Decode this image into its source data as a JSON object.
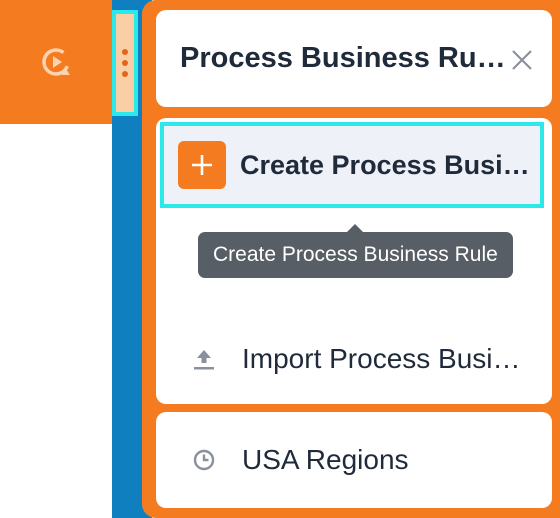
{
  "sidebar": {
    "tab_icon": "process-cycle-icon"
  },
  "kebab_menu": {
    "icon": "vertical-dots-icon"
  },
  "panel": {
    "title": "Process Business Rules",
    "close_icon": "close-icon",
    "menu": {
      "create_label": "Create Process Business Rule",
      "create_icon": "plus-icon",
      "tooltip": "Create Process Business Rule",
      "import_label": "Import Process Business Rules",
      "import_icon": "upload-icon"
    },
    "regions": {
      "label": "USA Regions",
      "icon": "clock-icon"
    }
  },
  "colors": {
    "accent_orange": "#f47b20",
    "focus_cyan": "#2be8ea",
    "strip_blue": "#0f7fbf",
    "text_dark": "#1f2a3a",
    "tooltip_bg": "#585e66"
  }
}
